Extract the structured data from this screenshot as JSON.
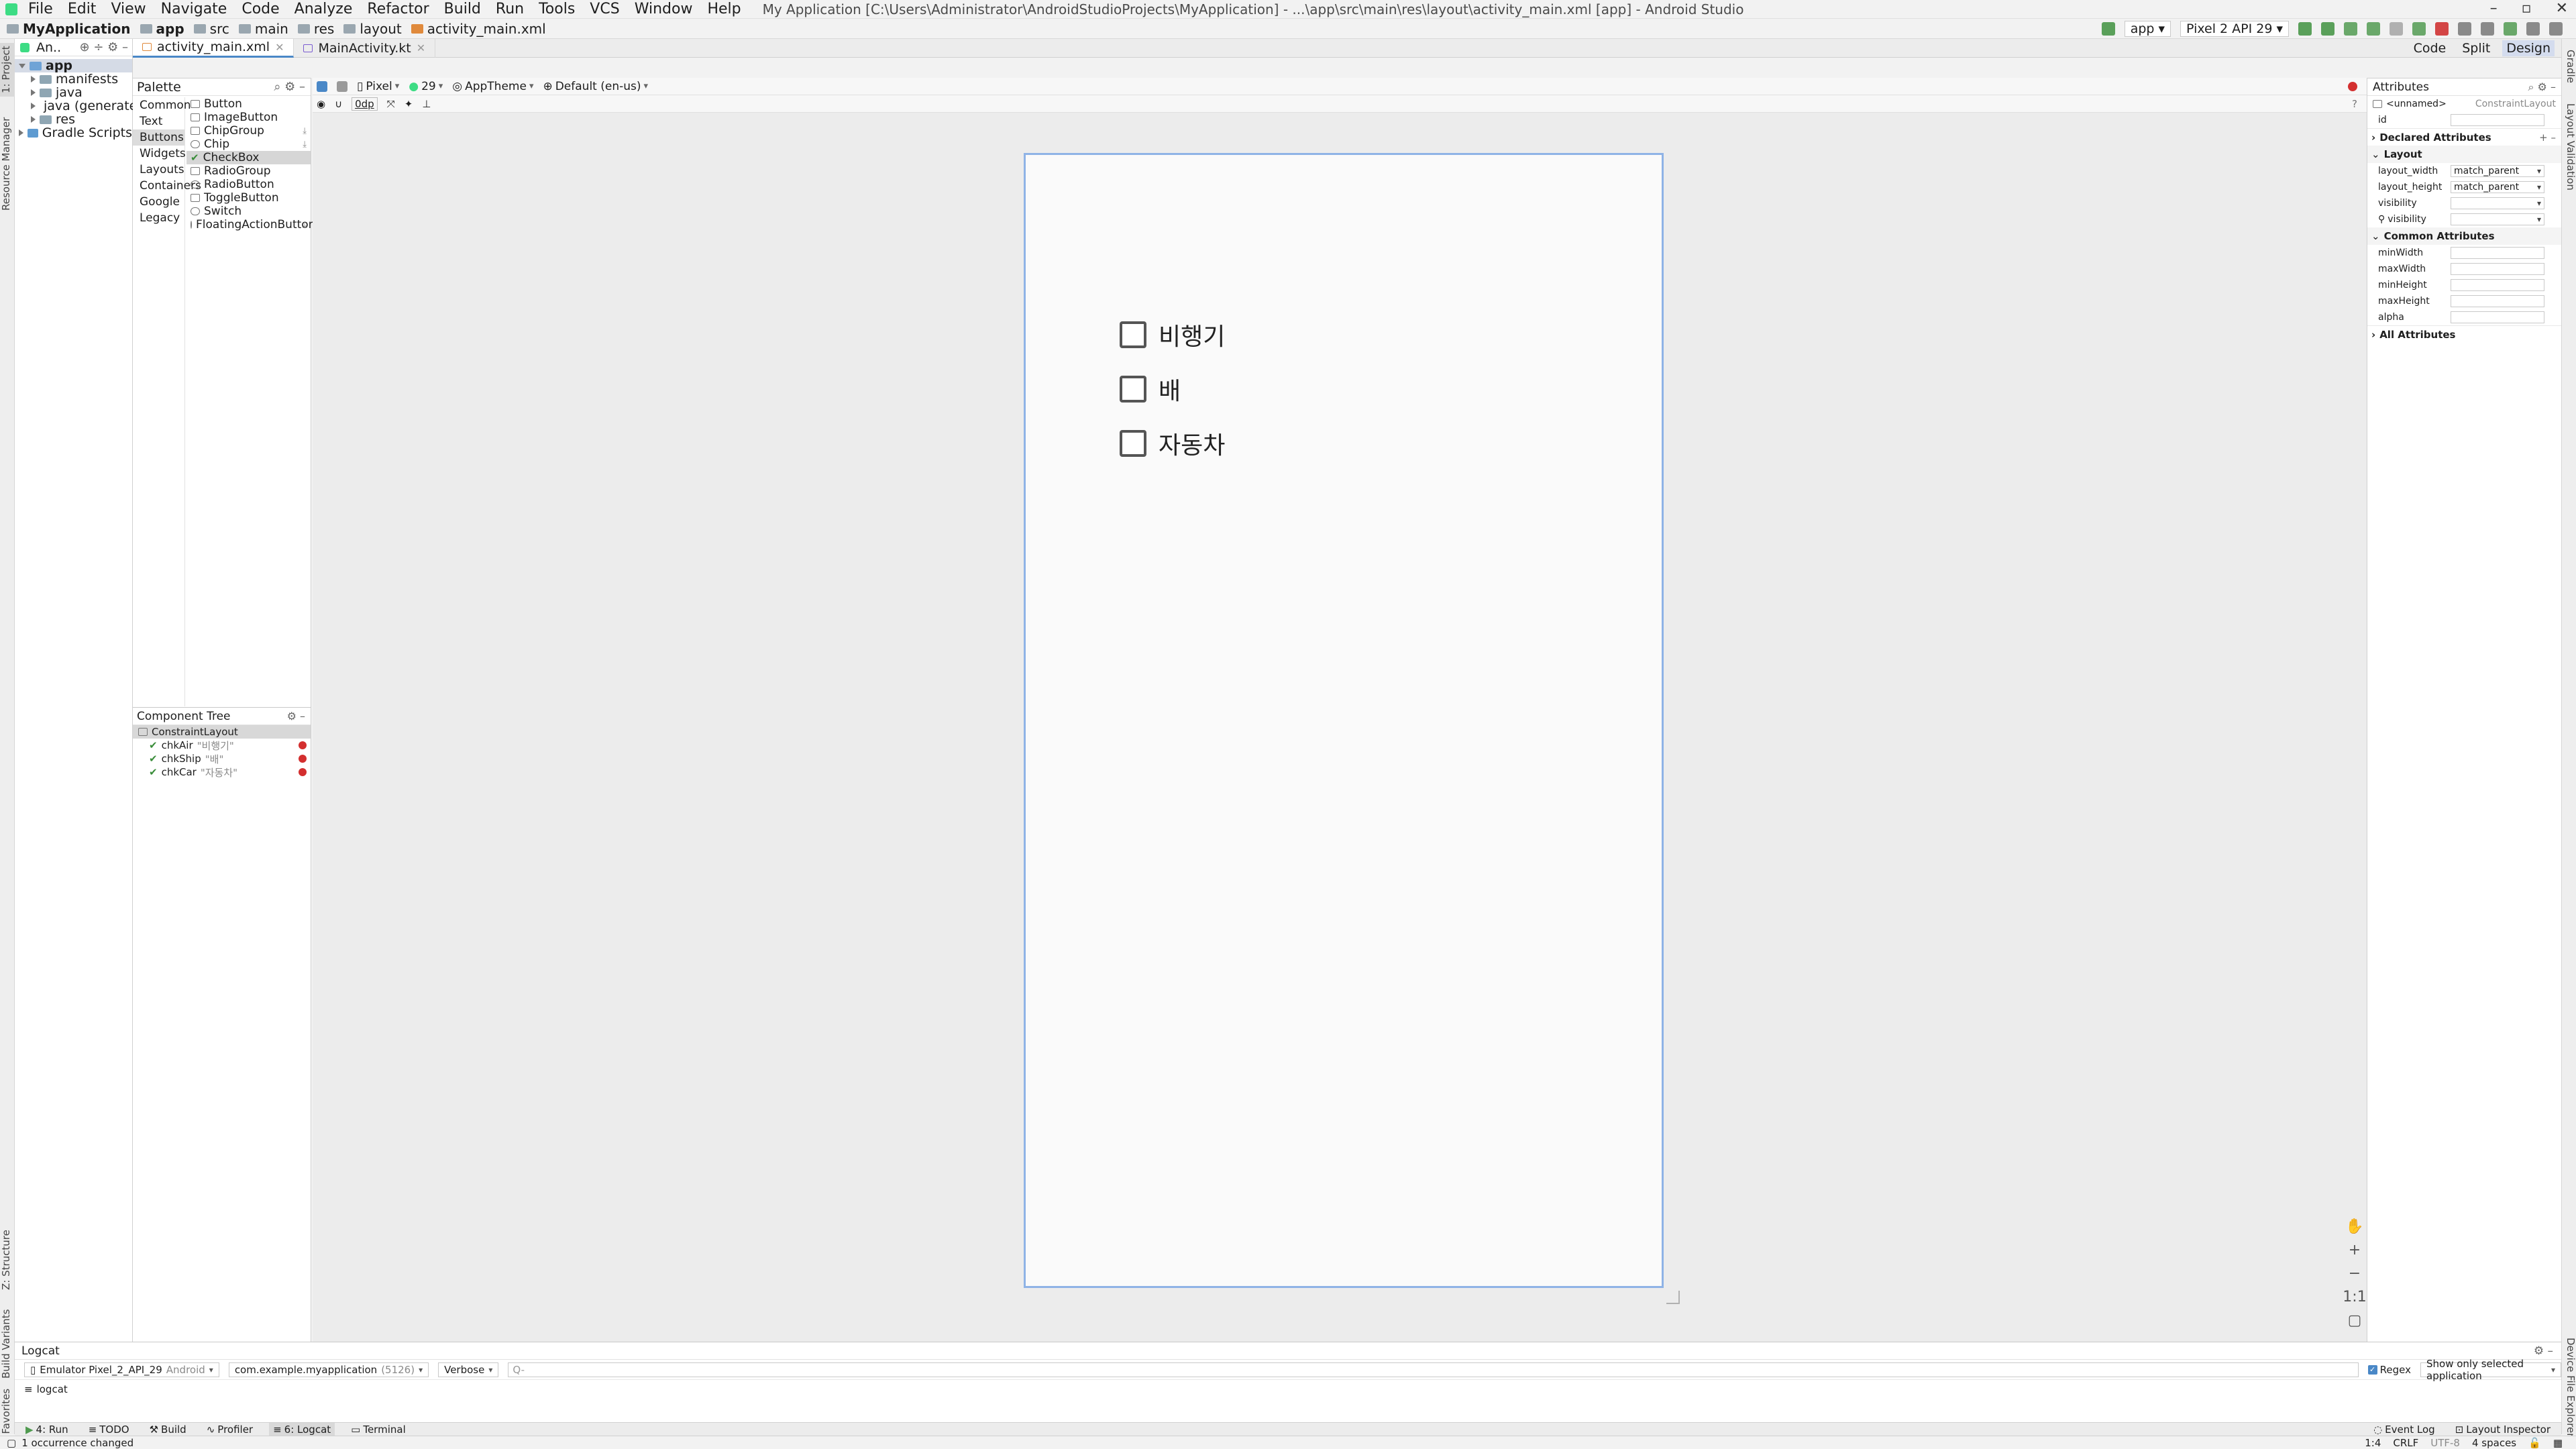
{
  "window": {
    "title": "My Application [C:\\Users\\Administrator\\AndroidStudioProjects\\MyApplication] - ...\\app\\src\\main\\res\\layout\\activity_main.xml [app] - Android Studio",
    "menu": [
      "File",
      "Edit",
      "View",
      "Navigate",
      "Code",
      "Analyze",
      "Refactor",
      "Build",
      "Run",
      "Tools",
      "VCS",
      "Window",
      "Help"
    ]
  },
  "breadcrumb": [
    "MyApplication",
    "app",
    "src",
    "main",
    "res",
    "layout",
    "activity_main.xml"
  ],
  "run_config": {
    "module": "app",
    "device": "Pixel 2 API 29"
  },
  "left_strip": {
    "project": "1: Project",
    "resource_manager": "Resource Manager",
    "structure": "Z: Structure",
    "build_variants": "Build Variants",
    "favorites": "2: Favorites"
  },
  "right_strip": {
    "gradle": "Gradle",
    "layout_validation": "Layout Validation",
    "device_file_explorer": "Device File Explorer"
  },
  "project": {
    "view_label": "An..",
    "tree": [
      {
        "label": "app",
        "bold": true,
        "expanded": true,
        "indent": 0
      },
      {
        "label": "manifests",
        "indent": 1
      },
      {
        "label": "java",
        "indent": 1
      },
      {
        "label": "java (generated)",
        "indent": 1
      },
      {
        "label": "res",
        "indent": 1
      },
      {
        "label": "Gradle Scripts",
        "indent": 0
      }
    ]
  },
  "editor_tabs": [
    {
      "label": "activity_main.xml",
      "active": true
    },
    {
      "label": "MainActivity.kt",
      "active": false
    }
  ],
  "view_modes": {
    "code": "Code",
    "split": "Split",
    "design": "Design"
  },
  "palette": {
    "title": "Palette",
    "categories": [
      "Common",
      "Text",
      "Buttons",
      "Widgets",
      "Layouts",
      "Containers",
      "Google",
      "Legacy"
    ],
    "selected_category": "Buttons",
    "items": [
      {
        "label": "Button"
      },
      {
        "label": "ImageButton"
      },
      {
        "label": "ChipGroup",
        "download": true
      },
      {
        "label": "Chip",
        "download": true
      },
      {
        "label": "CheckBox",
        "selected": true
      },
      {
        "label": "RadioGroup"
      },
      {
        "label": "RadioButton"
      },
      {
        "label": "ToggleButton"
      },
      {
        "label": "Switch"
      },
      {
        "label": "FloatingActionButton",
        "download": true
      }
    ]
  },
  "component_tree": {
    "title": "Component Tree",
    "root": "ConstraintLayout",
    "children": [
      {
        "id": "chkAir",
        "text": "\"비행기\""
      },
      {
        "id": "chkShip",
        "text": "\"배\""
      },
      {
        "id": "chkCar",
        "text": "\"자동차\""
      }
    ]
  },
  "design_toolbar": {
    "device": "Pixel",
    "api": "29",
    "theme": "AppTheme",
    "locale": "Default (en-us)",
    "margin": "0dp"
  },
  "preview": {
    "checkboxes": [
      {
        "label": "비행기",
        "checked": false
      },
      {
        "label": "배",
        "checked": false
      },
      {
        "label": "자동차",
        "checked": false
      }
    ]
  },
  "attributes": {
    "title": "Attributes",
    "component": "<unnamed>",
    "component_type": "ConstraintLayout",
    "id_label": "id",
    "declared_section": "Declared Attributes",
    "layout_section": "Layout",
    "layout_rows": [
      {
        "name": "layout_width",
        "value": "match_parent"
      },
      {
        "name": "layout_height",
        "value": "match_parent"
      },
      {
        "name": "visibility",
        "value": ""
      },
      {
        "name": "visibility",
        "value": "",
        "tools": true
      }
    ],
    "common_section": "Common Attributes",
    "common_rows": [
      {
        "name": "minWidth"
      },
      {
        "name": "maxWidth"
      },
      {
        "name": "minHeight"
      },
      {
        "name": "maxHeight"
      },
      {
        "name": "alpha"
      }
    ],
    "all_section": "All Attributes"
  },
  "logcat": {
    "title": "Logcat",
    "device": "Emulator Pixel_2_API_29",
    "device_os": "Android",
    "process": "com.example.myapplication",
    "process_pid": "(5126)",
    "level": "Verbose",
    "search_placeholder": "Q-",
    "regex_label": "Regex",
    "filter": "Show only selected application",
    "tab": "logcat"
  },
  "bottom_tabs": [
    {
      "label": "4: Run"
    },
    {
      "label": "TODO"
    },
    {
      "label": "Build"
    },
    {
      "label": "Profiler"
    },
    {
      "label": "6: Logcat",
      "active": true
    },
    {
      "label": "Terminal"
    }
  ],
  "bottom_right_tabs": [
    "Event Log",
    "Layout Inspector"
  ],
  "status": {
    "message": "1 occurrence changed",
    "position": "1:4",
    "line_sep": "CRLF",
    "encoding": "UTF-8",
    "indent": "4 spaces"
  },
  "colors": {
    "accent": "#4a88c7",
    "error": "#d32f2f",
    "device_border": "#8fb3e6"
  }
}
